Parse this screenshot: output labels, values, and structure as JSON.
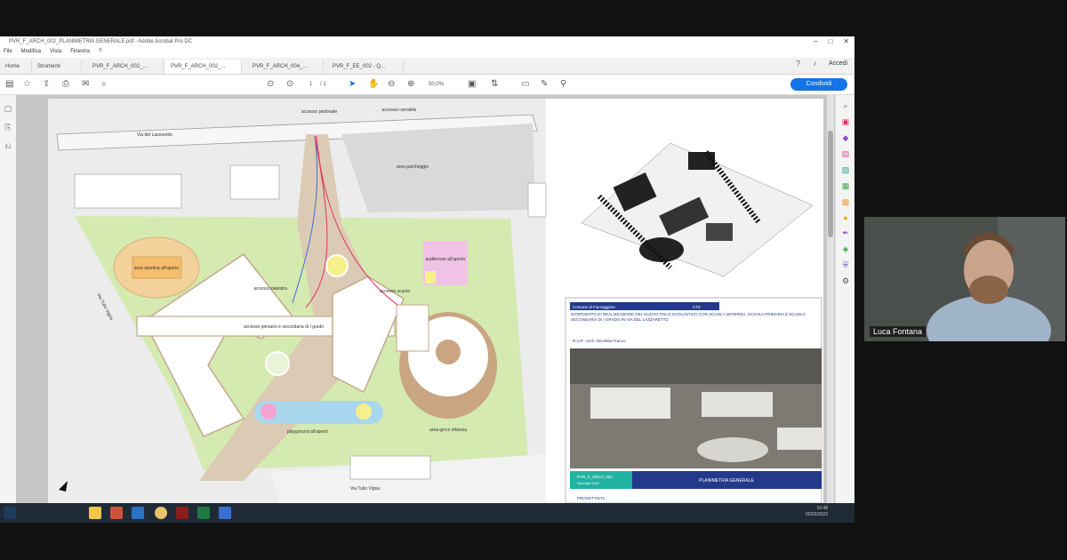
{
  "window": {
    "title": "PVR_F_ARCH_002_PLANIMETRIA GENERALE.pdf - Adobe Acrobat Pro DC"
  },
  "menu": [
    "File",
    "Modifica",
    "Vista",
    "Finestra",
    "?"
  ],
  "tabs": {
    "home": "Home",
    "tools": "Strumenti",
    "docs": [
      "PVR_F_ARCH_002_...",
      "PVR_F_ARCH_002_...",
      "PVR_F_ARCH_004_...",
      "PVR_F_EE_002 - Q..."
    ]
  },
  "header_right": {
    "account": "Accedi"
  },
  "toolbar": {
    "page_label": "1",
    "page_total": "/ 1",
    "zoom": "50,0%",
    "share_label": "Condividi"
  },
  "plan": {
    "street_top": "Via del Lazzaretto",
    "street_left": "Via Tullo Vigna",
    "street_bottom": "Via Tullo Vigna",
    "labels": {
      "pedestrian": "accesso\npedonale",
      "vehicle": "accesso\ncarrabile",
      "parking": "area\nparcheggio",
      "sport": "area sportiva\nall'aperto",
      "gym_access": "accesso\npalestra",
      "main_access": "accesso primario e\nsecondaria di I grado",
      "auditorium": "auditorium\nall'aperto",
      "school_access": "accesso\nscuola",
      "playground": "playground\nall'aperto",
      "play_area": "area gioco\ninfanzia"
    }
  },
  "title_block": {
    "municipality": "Comune di Fiumaggiore",
    "tag": "CTE",
    "description": "INTERVENTO DI REALIZZAZIONE DEL NUOVO POLO SCOLASTICO CON SCUOLA MATERNA, SCUOLA PRIMARIA E SCUOLA SECONDARIA DI I GRADO IN VIA DEL LAZZARETTO",
    "rup": "R.U.P.: Arch. Nicoletta Franco",
    "code": "PVR_F_ARCH_002",
    "revision": "Gennaio 2022",
    "sheet_name": "PLANIMETRIA GENERALE",
    "footer": "PROGETTISTA"
  },
  "taskbar": {
    "time": "10:48",
    "date": "02/02/2022"
  },
  "webcam": {
    "name": "Luca Fontana"
  }
}
